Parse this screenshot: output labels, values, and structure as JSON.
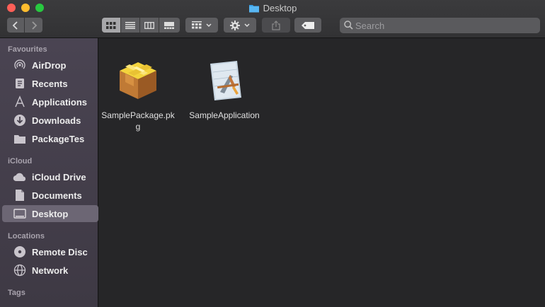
{
  "window": {
    "title": "Desktop"
  },
  "toolbar": {
    "search_placeholder": "Search"
  },
  "sidebar": {
    "sections": [
      {
        "label": "Favourites"
      },
      {
        "label": "iCloud"
      },
      {
        "label": "Locations"
      },
      {
        "label": "Tags"
      }
    ],
    "items": [
      {
        "label": "AirDrop",
        "icon": "airdrop-icon"
      },
      {
        "label": "Recents",
        "icon": "recents-icon"
      },
      {
        "label": "Applications",
        "icon": "applications-icon"
      },
      {
        "label": "Downloads",
        "icon": "downloads-icon"
      },
      {
        "label": "PackageTes",
        "icon": "folder-icon"
      },
      {
        "label": "iCloud Drive",
        "icon": "cloud-icon"
      },
      {
        "label": "Documents",
        "icon": "document-icon"
      },
      {
        "label": "Desktop",
        "icon": "desktop-icon",
        "selected": true
      },
      {
        "label": "Remote Disc",
        "icon": "disc-icon"
      },
      {
        "label": "Network",
        "icon": "network-icon"
      }
    ]
  },
  "files": [
    {
      "name": "SamplePackage.pkg",
      "icon": "package-icon"
    },
    {
      "name": "SampleApplication",
      "icon": "application-icon"
    }
  ],
  "colors": {
    "selection": "#6c6674",
    "accent_folder": "#3aa0e8"
  }
}
